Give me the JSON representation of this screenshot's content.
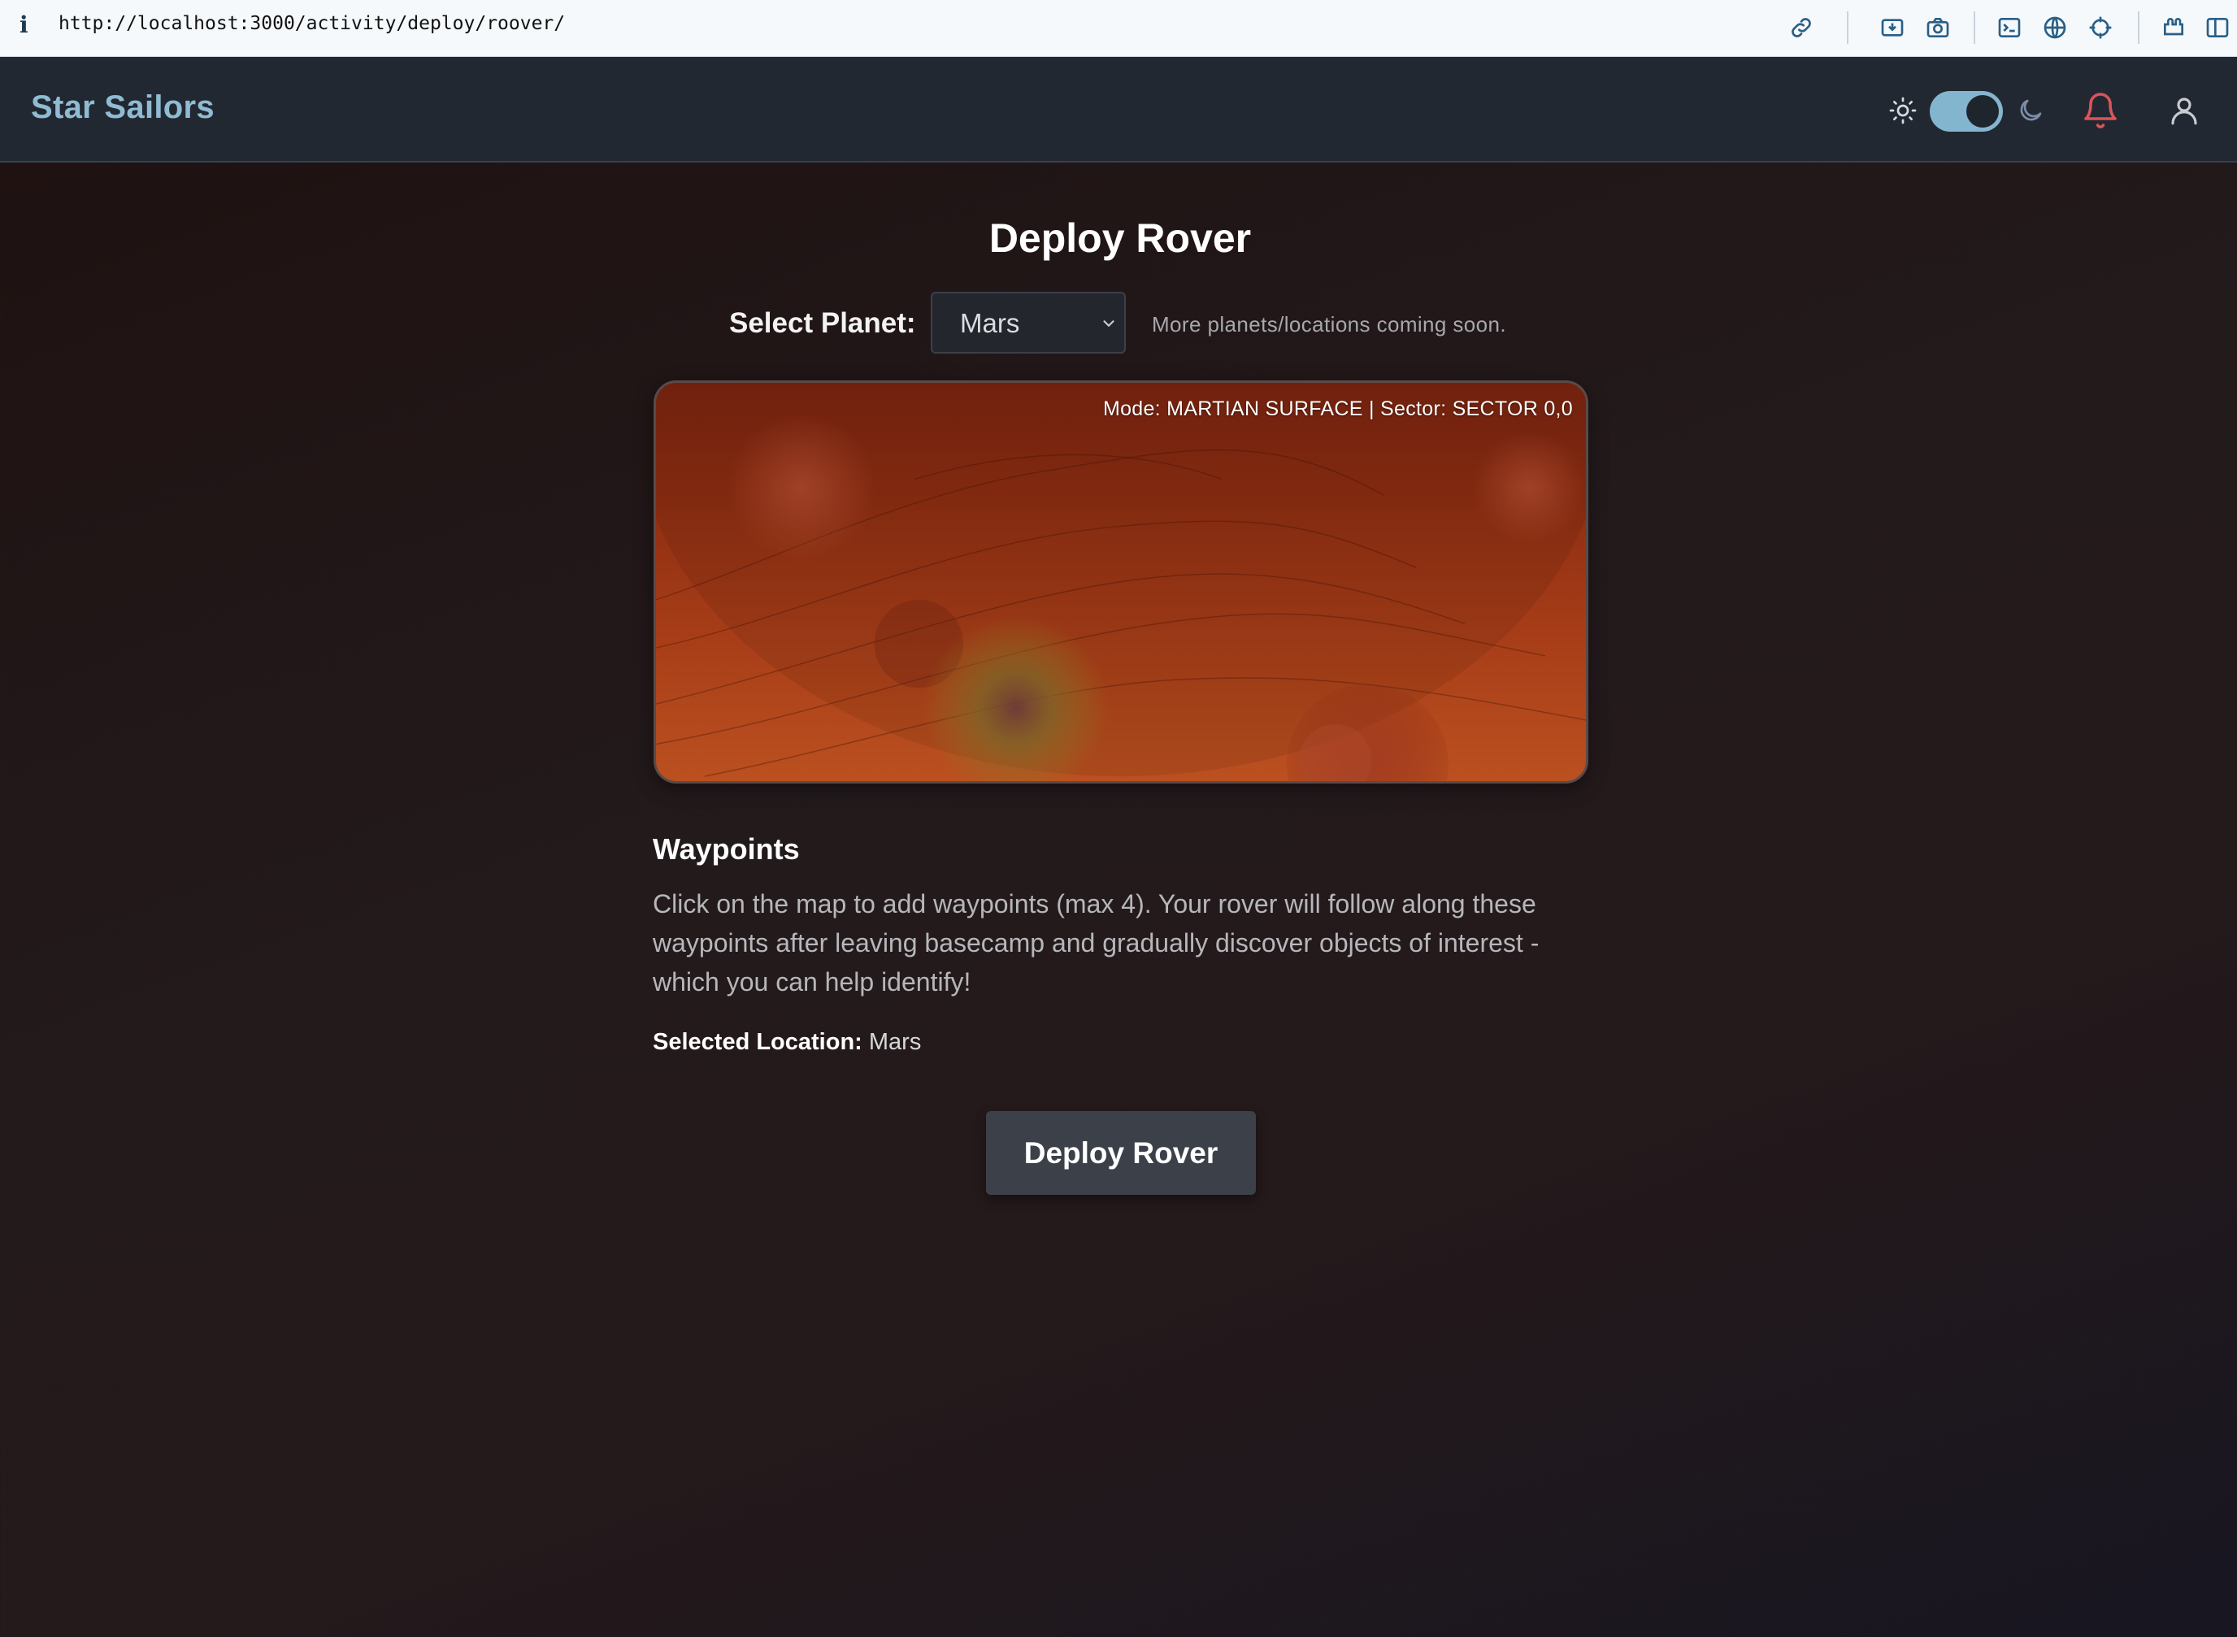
{
  "browser": {
    "url": "http://localhost:3000/activity/deploy/roover/",
    "info_glyph": "i",
    "toolbar_icons": [
      "link-icon",
      "save-page-icon",
      "camera-icon",
      "terminal-icon",
      "globe-icon",
      "crosshair-icon",
      "extensions-icon",
      "sidebar-icon"
    ]
  },
  "header": {
    "brand": "Star Sailors",
    "theme": "dark",
    "icons": [
      "sun-icon",
      "moon-icon",
      "bell-icon",
      "user-icon"
    ]
  },
  "main": {
    "title": "Deploy Rover",
    "planet_label": "Select Planet:",
    "planet_selected": "Mars",
    "coming_soon": "More planets/locations coming soon.",
    "map_mode": "Mode: MARTIAN SURFACE | Sector: SECTOR 0,0",
    "waypoints_heading": "Waypoints",
    "waypoints_desc": "Click on the map to add waypoints (max 4). Your rover will follow along these waypoints after leaving basecamp and gradually discover objects of interest - which you can help identify!",
    "selected_location_label": "Selected Location:",
    "selected_location_value": "Mars",
    "deploy_button": "Deploy Rover"
  },
  "colors": {
    "brand": "#8fbcd2",
    "header_bg": "#222831",
    "toggle": "#84b5cf",
    "bell": "#d9555b",
    "mars_dark": "#7a2410",
    "mars_light": "#bb5020",
    "button_bg": "#3c4149"
  }
}
